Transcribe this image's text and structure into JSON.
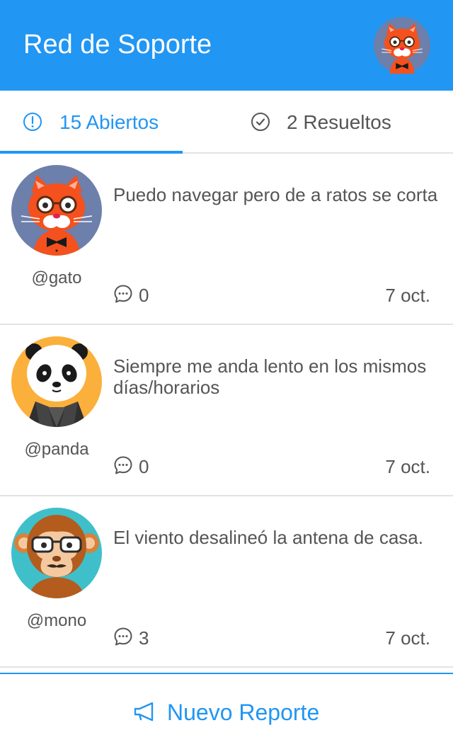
{
  "header": {
    "title": "Red de Soporte",
    "avatar_icon": "cat-avatar-icon",
    "background_color": "#2196f3"
  },
  "tabs": [
    {
      "label": "15 Abiertos",
      "icon": "alert-circle-icon",
      "active": true,
      "color": "#2196f3"
    },
    {
      "label": "2 Resueltos",
      "icon": "check-circle-icon",
      "active": false,
      "color": "#555555"
    }
  ],
  "tickets": [
    {
      "user": "@gato",
      "avatar": "cat-avatar-icon",
      "text": "Puedo navegar pero de a ratos se corta",
      "comments": "0",
      "date": "7 oct."
    },
    {
      "user": "@panda",
      "avatar": "panda-avatar-icon",
      "text": "Siempre me anda lento en los mismos días/horarios",
      "comments": "0",
      "date": "7 oct."
    },
    {
      "user": "@mono",
      "avatar": "monkey-avatar-icon",
      "text": "El viento desalineó la antena de casa.",
      "comments": "3",
      "date": "7 oct."
    }
  ],
  "footer": {
    "label": "Nuevo Reporte",
    "icon": "megaphone-icon"
  }
}
